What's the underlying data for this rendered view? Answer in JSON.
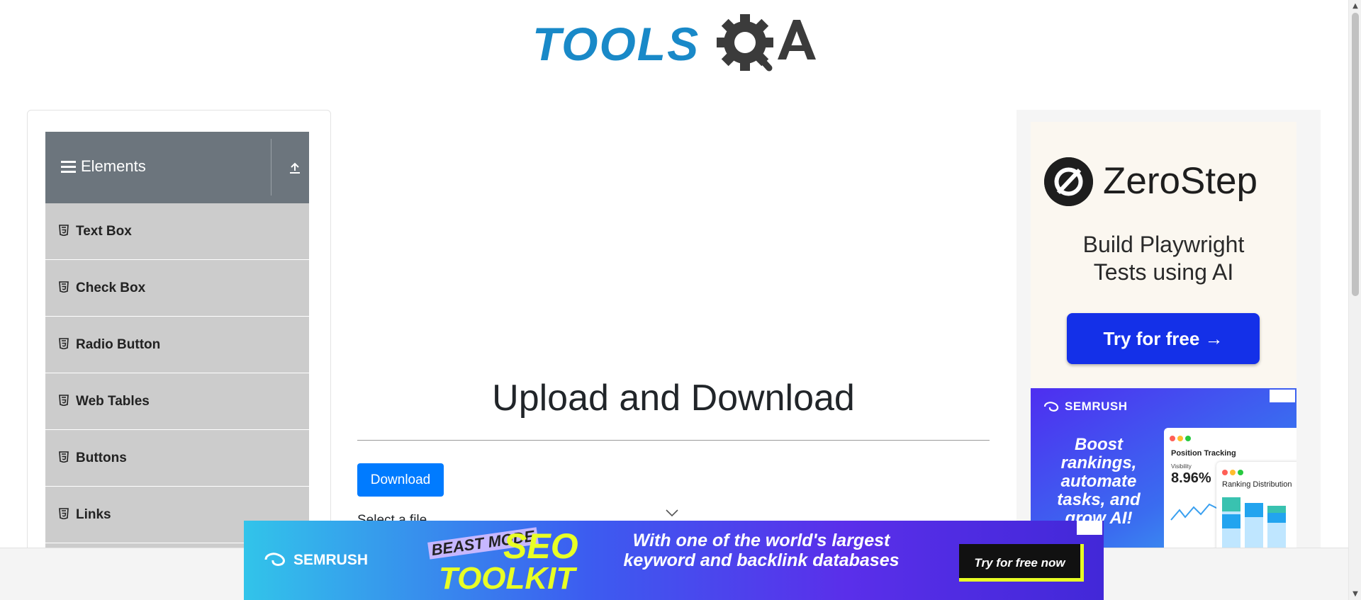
{
  "logo": {
    "word": "TOOLS",
    "qa_letters": "QA"
  },
  "sidebar": {
    "group_title": "Elements",
    "items": [
      {
        "label": "Text Box"
      },
      {
        "label": "Check Box"
      },
      {
        "label": "Radio Button"
      },
      {
        "label": "Web Tables"
      },
      {
        "label": "Buttons"
      },
      {
        "label": "Links"
      }
    ]
  },
  "main": {
    "title": "Upload and Download",
    "download_label": "Download",
    "select_file_label": "Select a file"
  },
  "right_ad": {
    "brand": "ZeroStep",
    "tagline_line1": "Build Playwright",
    "tagline_line2": "Tests using AI",
    "cta": "Try for free →"
  },
  "semrush_side_ad": {
    "brand": "SEMRUSH",
    "headline": "Boost rankings, automate tasks, and grow AI!",
    "panel_title": "Position Tracking",
    "visibility_label": "Visibility",
    "visibility_value": "8.96%",
    "panel2_title": "Ranking Distribution"
  },
  "banner_ad": {
    "brand": "SEMRUSH",
    "beast_mode": "BEAST MODE",
    "seo": "SEO",
    "toolkit": "TOOLKIT",
    "text": "With one of the world's largest keyword and backlink databases",
    "cta": "Try for free now"
  },
  "colors": {
    "brand_blue": "#1989c8",
    "header_gray": "#6c757d",
    "item_gray": "#cccccc",
    "primary_button": "#007bff",
    "zerostep_cta": "#1430e8"
  }
}
